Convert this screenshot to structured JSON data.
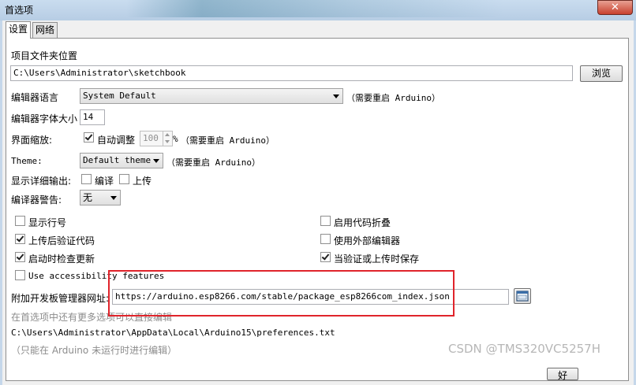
{
  "window": {
    "title": "首选项",
    "close_glyph": "✕"
  },
  "tabs": [
    {
      "label": "设置",
      "active": true
    },
    {
      "label": "网络",
      "active": false
    }
  ],
  "sketchbook": {
    "label": "项目文件夹位置",
    "path": "C:\\Users\\Administrator\\sketchbook",
    "browse_label": "浏览"
  },
  "editor_language": {
    "label": "编辑器语言",
    "value": "System Default",
    "note": "（需要重启 Arduino）"
  },
  "editor_font_size": {
    "label": "编辑器字体大小",
    "value": "14"
  },
  "interface_scale": {
    "label": "界面缩放:",
    "auto_label": "自动调整",
    "auto_checked": true,
    "value": "100",
    "percent": "%",
    "note": "（需要重启 Arduino）"
  },
  "theme": {
    "label": "Theme:",
    "value": "Default theme",
    "note": "（需要重启 Arduino）"
  },
  "verbose_output": {
    "label": "显示详细输出:",
    "compile_label": "编译",
    "compile_checked": false,
    "upload_label": "上传",
    "upload_checked": false
  },
  "compiler_warnings": {
    "label": "编译器警告:",
    "value": "无"
  },
  "options_left": [
    {
      "label": "显示行号",
      "checked": false
    },
    {
      "label": "上传后验证代码",
      "checked": true
    },
    {
      "label": "启动时检查更新",
      "checked": true
    },
    {
      "label": "Use accessibility features",
      "checked": false
    }
  ],
  "options_right": [
    {
      "label": "启用代码折叠",
      "checked": false
    },
    {
      "label": "使用外部编辑器",
      "checked": false
    },
    {
      "label": "当验证或上传时保存",
      "checked": true
    }
  ],
  "board_manager": {
    "label": "附加开发板管理器网址:",
    "url": "https://arduino.esp8266.com/stable/package_esp8266com_index.json"
  },
  "footer": {
    "more_prefs": "在首选项中还有更多选项可以直接编辑",
    "prefs_path": "C:\\Users\\Administrator\\AppData\\Local\\Arduino15\\preferences.txt",
    "edit_note": "（只能在 Arduino 未运行时进行编辑）"
  },
  "ok_label": "好",
  "watermark": "CSDN @TMS320VC5257H",
  "colors": {
    "highlight_box": "#e0242b",
    "window_frame": "#c5d7ea"
  }
}
